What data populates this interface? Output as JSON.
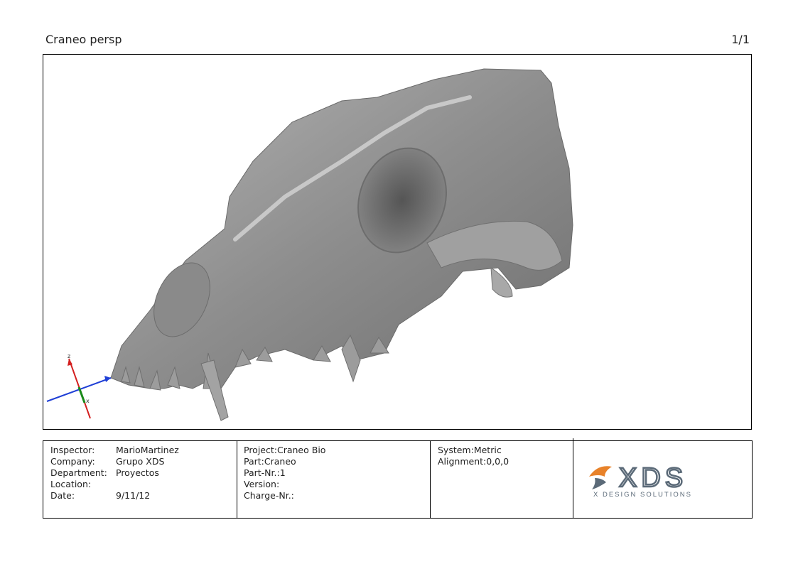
{
  "header": {
    "title": "Craneo persp",
    "page": "1/1"
  },
  "viewport": {
    "subject": "skull-3d-scan",
    "axis_labels": {
      "z": "z",
      "x": "x"
    },
    "colors": {
      "x_axis": "#1f3fd6",
      "y_axis": "#1a8a1a",
      "z_axis": "#d42020",
      "mesh": "#8f8f8f"
    }
  },
  "info": {
    "inspector": {
      "label": "Inspector:",
      "value": "MarioMartinez"
    },
    "company": {
      "label": "Company:",
      "value": "Grupo XDS"
    },
    "department": {
      "label": "Department:",
      "value": "Proyectos"
    },
    "location": {
      "label": "Location:",
      "value": ""
    },
    "date": {
      "label": "Date:",
      "value": "9/11/12"
    },
    "project": "Project:Craneo Bio",
    "part": "Part:Craneo",
    "part_nr": "Part-Nr.:1",
    "version": "Version:",
    "charge_nr": "Charge-Nr.:",
    "system": "System:Metric",
    "alignment": "Alignment:0,0,0"
  },
  "logo": {
    "text": "XDS",
    "tagline": "X DESIGN SOLUTIONS",
    "colors": {
      "accent": "#e8822a",
      "dark": "#5b6a78"
    }
  }
}
